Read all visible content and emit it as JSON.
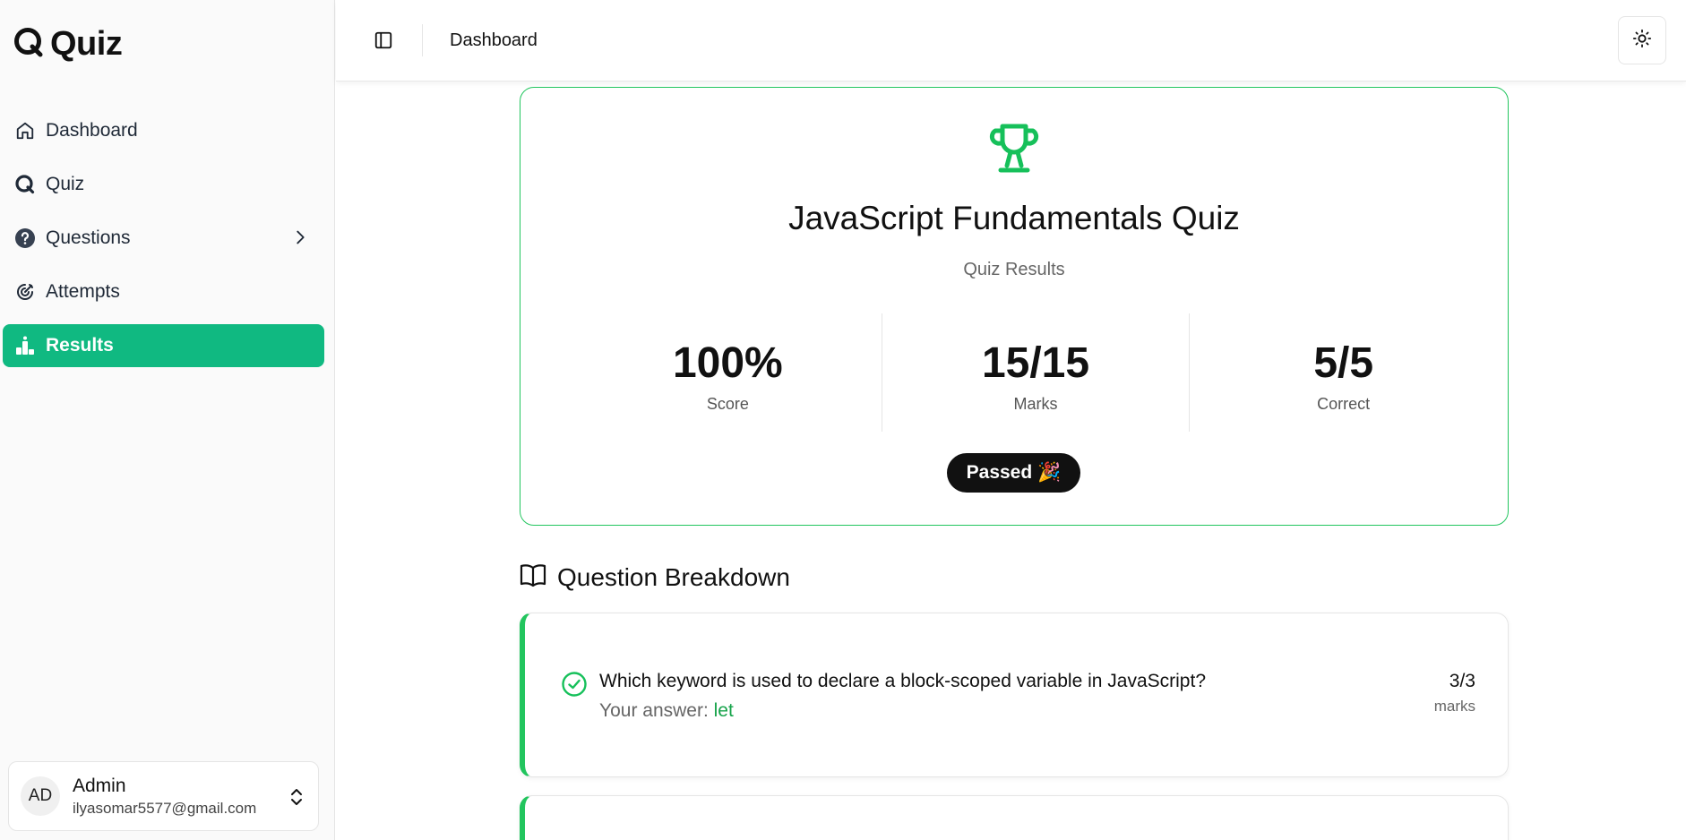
{
  "brand": {
    "name": "Quiz"
  },
  "sidebar": {
    "items": [
      {
        "label": "Dashboard",
        "icon": "home-icon"
      },
      {
        "label": "Quiz",
        "icon": "quiz-logo-icon"
      },
      {
        "label": "Questions",
        "icon": "question-circle-icon"
      },
      {
        "label": "Attempts",
        "icon": "target-icon"
      },
      {
        "label": "Results",
        "icon": "podium-icon",
        "active": true
      }
    ]
  },
  "user": {
    "initials": "AD",
    "name": "Admin",
    "email": "ilyasomar5577@gmail.com"
  },
  "header": {
    "title": "Dashboard"
  },
  "result": {
    "quiz_title": "JavaScript Fundamentals Quiz",
    "subtitle": "Quiz Results",
    "stats": [
      {
        "value": "100%",
        "label": "Score"
      },
      {
        "value": "15/15",
        "label": "Marks"
      },
      {
        "value": "5/5",
        "label": "Correct"
      }
    ],
    "status": "Passed",
    "status_emoji": "🎉",
    "accent_color": "#22c55e"
  },
  "breakdown": {
    "title": "Question Breakdown",
    "questions": [
      {
        "text": "Which keyword is used to declare a block-scoped variable in JavaScript?",
        "answer_prefix": "Your answer: ",
        "answer": "let",
        "marks": "3/3",
        "marks_label": "marks"
      }
    ]
  },
  "colors": {
    "active_nav": "#10b981",
    "correct": "#16a34a"
  }
}
